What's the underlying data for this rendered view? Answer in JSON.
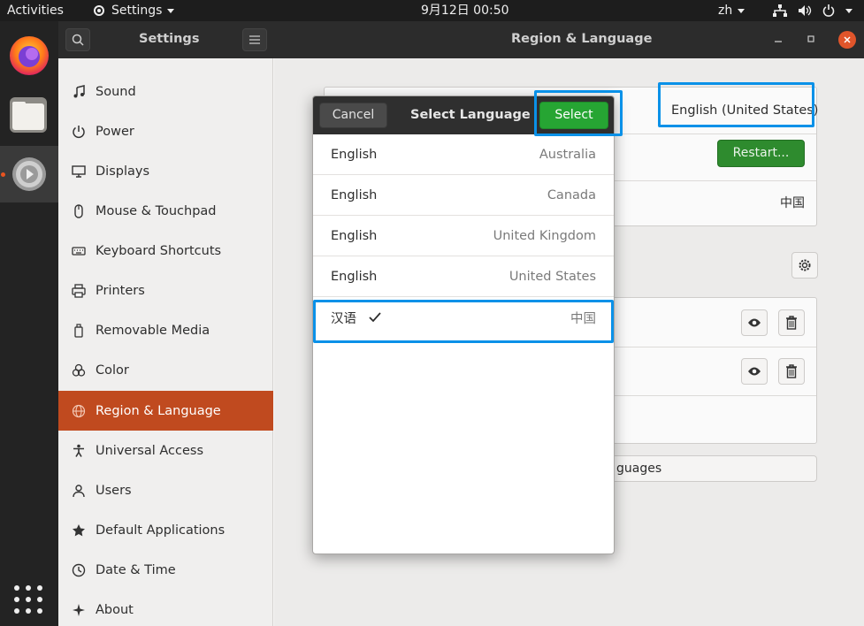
{
  "topbar": {
    "activities": "Activities",
    "app_menu": "Settings",
    "clock": "9月12日  00:50",
    "input_method": "zh"
  },
  "window": {
    "sidebar_title": "Settings",
    "title": "Region & Language"
  },
  "sidebar": {
    "items": [
      {
        "label": "Sound",
        "icon": "music-note-icon"
      },
      {
        "label": "Power",
        "icon": "power-icon"
      },
      {
        "label": "Displays",
        "icon": "display-icon"
      },
      {
        "label": "Mouse & Touchpad",
        "icon": "mouse-icon"
      },
      {
        "label": "Keyboard Shortcuts",
        "icon": "keyboard-icon"
      },
      {
        "label": "Printers",
        "icon": "printer-icon"
      },
      {
        "label": "Removable Media",
        "icon": "usb-drive-icon"
      },
      {
        "label": "Color",
        "icon": "color-icon"
      },
      {
        "label": "Region & Language",
        "icon": "globe-icon"
      },
      {
        "label": "Universal Access",
        "icon": "accessibility-icon"
      },
      {
        "label": "Users",
        "icon": "user-icon"
      },
      {
        "label": "Default Applications",
        "icon": "star-icon"
      },
      {
        "label": "Date & Time",
        "icon": "clock-icon"
      },
      {
        "label": "About",
        "icon": "sparkle-icon"
      }
    ]
  },
  "content": {
    "language_value": "English (United States)",
    "restart_label": "Restart...",
    "formats_value": "中国",
    "manage_languages_partial": "guages"
  },
  "dialog": {
    "cancel_label": "Cancel",
    "title": "Select Language",
    "select_label": "Select",
    "languages": [
      {
        "name": "English",
        "region": "Australia"
      },
      {
        "name": "English",
        "region": "Canada"
      },
      {
        "name": "English",
        "region": "United Kingdom"
      },
      {
        "name": "English",
        "region": "United States"
      },
      {
        "name": "汉语",
        "region": "中国",
        "selected": true
      }
    ]
  },
  "colors": {
    "accent_orange": "#c04a1f",
    "select_green": "#26a533",
    "restart_green": "#2e8b2e",
    "highlight_blue": "#0a91e8"
  }
}
